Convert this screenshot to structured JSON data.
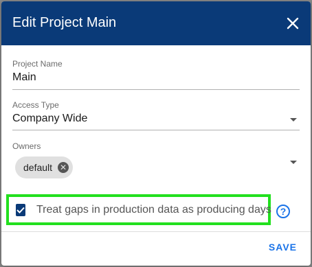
{
  "dialog": {
    "title": "Edit Project Main",
    "close_icon": "close-icon",
    "header_color": "#0a3a78"
  },
  "project_name": {
    "label": "Project Name",
    "value": "Main"
  },
  "access_type": {
    "label": "Access Type",
    "value": "Company Wide",
    "icon": "chevron-down-icon"
  },
  "owners": {
    "label": "Owners",
    "chips": [
      {
        "label": "default",
        "remove_icon": "remove-chip-icon"
      }
    ],
    "icon": "chevron-down-icon"
  },
  "gap_option": {
    "checked": true,
    "label": "Treat gaps in production data as producing days",
    "highlight_color": "#22e01e",
    "help_icon": "help-icon",
    "help_glyph": "?"
  },
  "actions": {
    "save_label": "SAVE",
    "accent_color": "#1a73e8"
  }
}
